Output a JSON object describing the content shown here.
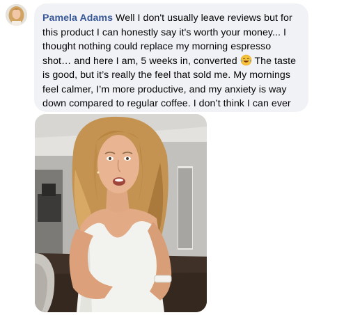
{
  "comment": {
    "author": "Pamela Adams",
    "text_before_emoji": "Well I don't usually leave reviews but for this product I can honestly say it's worth your money... I thought nothing could replace my morning espresso shot… and here I am, 5 weeks in, converted",
    "emoji_icon": "face-with-tears-of-joy",
    "text_after_emoji": "The taste is good, but it’s really the feel that sold me. My mornings feel calmer, I’m more productive, and my anxiety is way down compared to regular coffee. I don’t think I can ever go back."
  },
  "colors": {
    "bubble_background": "#f0f2f5",
    "author_name": "#385898",
    "text": "#050505"
  }
}
